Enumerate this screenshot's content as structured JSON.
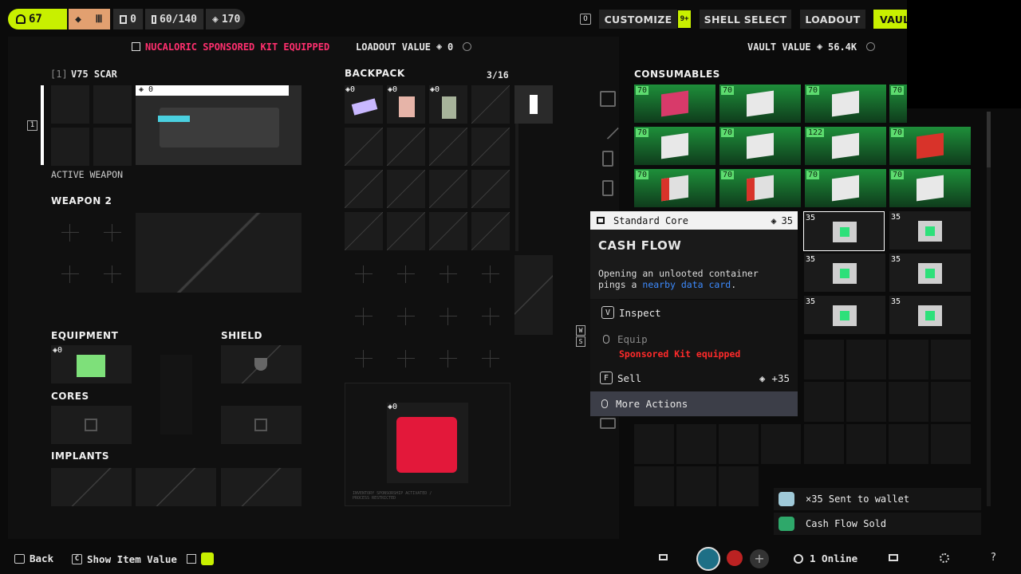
{
  "topbar": {
    "level": "67",
    "stat_a": "0",
    "weight": "60/140",
    "currency": "170",
    "key_hint": "O",
    "customize": "CUSTOMIZE",
    "customize_badge": "9+",
    "shell_select": "SHELL SELECT",
    "loadout": "LOADOUT",
    "vault": "VAUL"
  },
  "loadout_header": {
    "sponsor": "NUCALORIC SPONSORED KIT EQUIPPED",
    "value_label": "LOADOUT VALUE",
    "value": "0"
  },
  "vault_header": {
    "label": "VAULT VALUE",
    "value": "56.4K"
  },
  "weapon": {
    "slot_index": "[1]",
    "name": "V75 SCAR",
    "value": "0",
    "active_label": "ACTIVE WEAPON",
    "side_key": "1"
  },
  "weapon2": {
    "title": "WEAPON 2"
  },
  "equipment": {
    "title": "EQUIPMENT",
    "value": "0"
  },
  "shield": {
    "title": "SHIELD"
  },
  "cores": {
    "title": "CORES"
  },
  "implants": {
    "title": "IMPLANTS"
  },
  "backpack": {
    "title": "BACKPACK",
    "count": "3/16",
    "item_values": [
      "0",
      "0",
      "0"
    ],
    "sponsor_item_value": "0",
    "footer_text": "INVENTORY SPONSORSHIP ACTIVATED / PROCESS RESTRICTED"
  },
  "consumables": {
    "title": "CONSUMABLES",
    "green_values": [
      "70",
      "70",
      "70",
      "70",
      "70",
      "70",
      "122",
      "70",
      "70",
      "70",
      "70",
      "70"
    ],
    "dark_values": [
      "35",
      "35",
      "35",
      "35",
      "35",
      "35",
      "35"
    ]
  },
  "tooltip": {
    "category": "Standard Core",
    "price": "35",
    "title": "CASH FLOW",
    "desc_a": "Opening an unlooted container",
    "desc_b": "pings a",
    "desc_link": "nearby data card",
    "desc_end": "."
  },
  "context_menu": {
    "inspect_key": "V",
    "inspect": "Inspect",
    "equip": "Equip",
    "equip_warning": "Sponsored Kit equipped",
    "sell_key": "F",
    "sell": "Sell",
    "sell_value": "+35",
    "more": "More Actions"
  },
  "side_keys": [
    "W",
    "S"
  ],
  "notifications": [
    "×35 Sent to wallet",
    "Cash Flow Sold"
  ],
  "bottombar": {
    "back": "Back",
    "show_value_key": "C",
    "show_value": "Show Item Value",
    "online": "1 Online"
  },
  "colors": {
    "accent_lime": "#c8f000",
    "sponsor_pink": "#ff2f6e",
    "warning_red": "#ff2a2a",
    "link_blue": "#3d8bff",
    "consumable_green": "#1e8f3a"
  }
}
